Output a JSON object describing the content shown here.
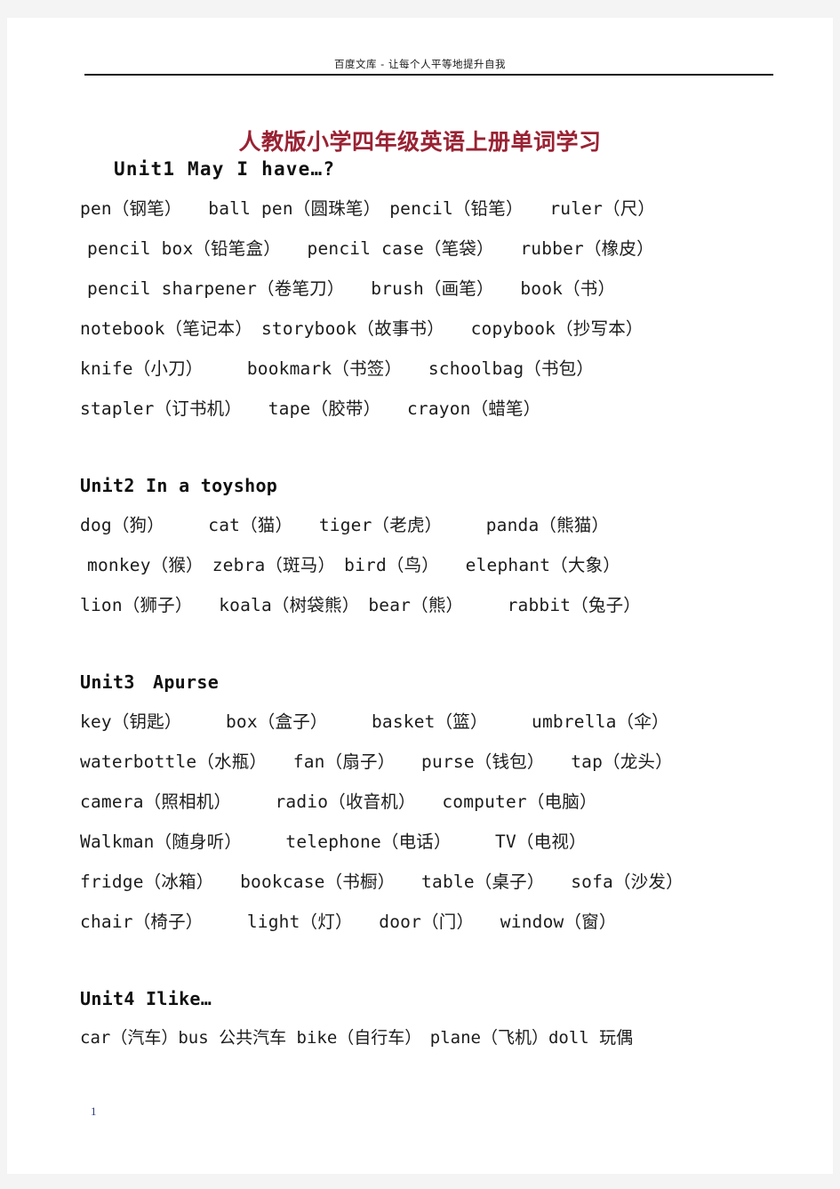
{
  "header": {
    "watermark": "百度文库 - 让每个人平等地提升自我"
  },
  "title": "人教版小学四年级英语上册单词学习",
  "colors": {
    "title": "#992233",
    "body_text": "#1c1c1c",
    "page_background": "#ffffff",
    "canvas_background": "#f4f4f4",
    "page_number": "#2b3a80"
  },
  "units": [
    {
      "heading": "Unit1 May I have…?",
      "lines": [
        "pen（钢笔）　　ball pen（圆珠笔）　pencil（铅笔）　　ruler（尺）",
        "pencil box（铅笔盒）　　pencil case（笔袋）　　rubber（橡皮）",
        "pencil sharpener（卷笔刀）　　brush（画笔）　　book（书）",
        "notebook（笔记本）　storybook（故事书）　　copybook（抄写本）",
        "knife（小刀）　　　bookmark（书签）　　schoolbag（书包）",
        "stapler（订书机）　　tape（胶带）　　crayon（蜡笔）"
      ]
    },
    {
      "heading": "Unit2 In a toyshop",
      "lines": [
        "dog（狗）　　　cat（猫）　　tiger（老虎）　　　panda（熊猫）",
        "monkey（猴）　zebra（斑马）　bird（鸟）　　elephant（大象）",
        "lion（狮子）　　koala（树袋熊）　bear（熊）　　　rabbit（兔子）"
      ]
    },
    {
      "heading": "Unit3　Apurse",
      "lines": [
        "key（钥匙）　　　box（盒子）　　　basket（篮）　　　umbrella（伞）",
        "waterbottle（水瓶）　　fan（扇子）　　purse（钱包）　　tap（龙头）",
        "camera（照相机）　　　radio（收音机）　　computer（电脑）",
        "Walkman（随身听）　　　telephone（电话）　　　TV（电视）",
        "fridge（冰箱）　　bookcase（书橱）　　table（桌子）　　sofa（沙发）",
        "chair（椅子）　　　light（灯）　　door（门）　　window（窗）"
      ]
    },
    {
      "heading": "Unit4 Ilike…",
      "lines": [
        "car（汽车）bus 公共汽车 bike（自行车）　plane（飞机）doll 玩偶"
      ]
    }
  ],
  "footer": {
    "page_number": "1"
  }
}
